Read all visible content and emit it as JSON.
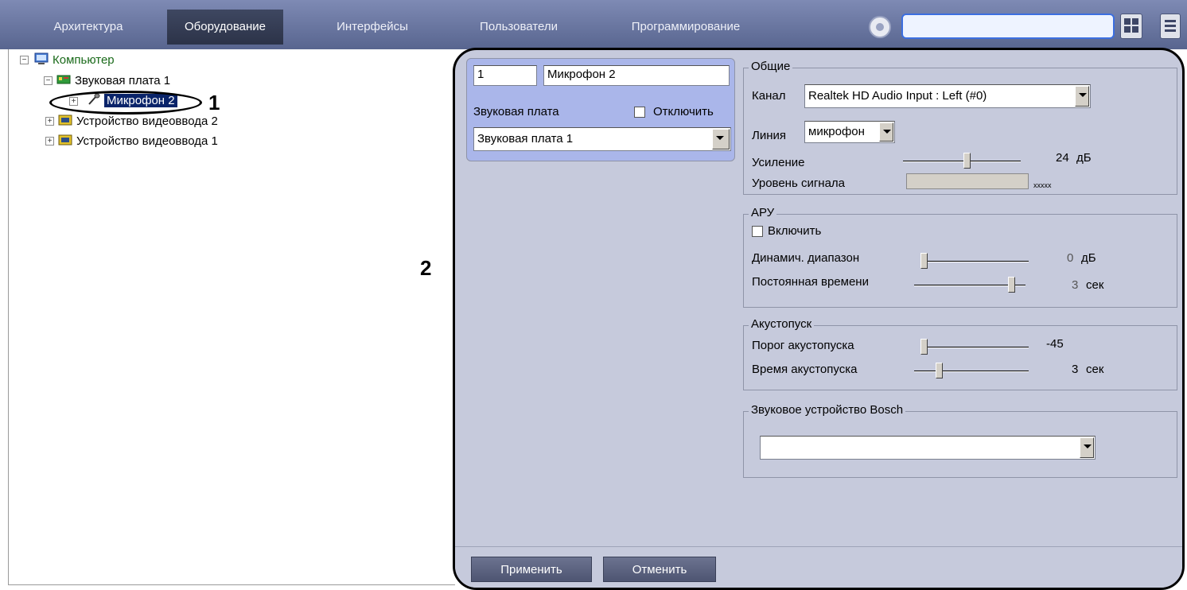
{
  "tabs": [
    {
      "label": "Архитектура"
    },
    {
      "label": "Оборудование",
      "active": true
    },
    {
      "label": "Интерфейсы"
    },
    {
      "label": "Пользователи"
    },
    {
      "label": "Программирование"
    }
  ],
  "toolbar": {
    "search_value": "",
    "icons": [
      "settings-gear-icon",
      "grid-view-icon",
      "menu-icon"
    ]
  },
  "tree": {
    "root": "Компьютер",
    "sound_card": "Звуковая плата 1",
    "microphone": "Микрофон 2",
    "video_2": "Устройство видеоввода 2",
    "video_1": "Устройство видеоввода 1"
  },
  "callouts": {
    "one": "1",
    "two": "2"
  },
  "object": {
    "id_value": "1",
    "name_value": "Микрофон 2",
    "parent_label": "Звуковая плата",
    "disable_label": "Отключить",
    "disable_checked": false,
    "parent_value": "Звуковая плата 1"
  },
  "general": {
    "title": "Общие",
    "channel_label": "Канал",
    "channel_value": "Realtek HD Audio Input : Left (#0)",
    "line_label": "Линия",
    "line_value": "микрофон",
    "gain_label": "Усиление",
    "gain_value": "24",
    "gain_unit": "дБ",
    "gain_level": 0.55,
    "signal_label": "Уровень сигнала",
    "signal_text": "xxxxx"
  },
  "agc": {
    "title": "АРУ",
    "enable_label": "Включить",
    "enable_checked": false,
    "range_label": "Динамич. диапазон",
    "range_value": "0",
    "range_unit": "дБ",
    "range_level": 0.0,
    "time_label": "Постоянная времени",
    "time_value": "3",
    "time_unit": "сек",
    "time_level": 0.9
  },
  "vox": {
    "title": "Акустопуск",
    "threshold_label": "Порог акустопуска",
    "threshold_value": "-45",
    "threshold_level": 0.0,
    "time_label": "Время акустопуска",
    "time_value": "3",
    "time_unit": "сек",
    "time_level": 0.2
  },
  "bosch": {
    "title": "Звуковое устройство Bosch",
    "value": ""
  },
  "buttons": {
    "apply": "Применить",
    "cancel": "Отменить"
  }
}
